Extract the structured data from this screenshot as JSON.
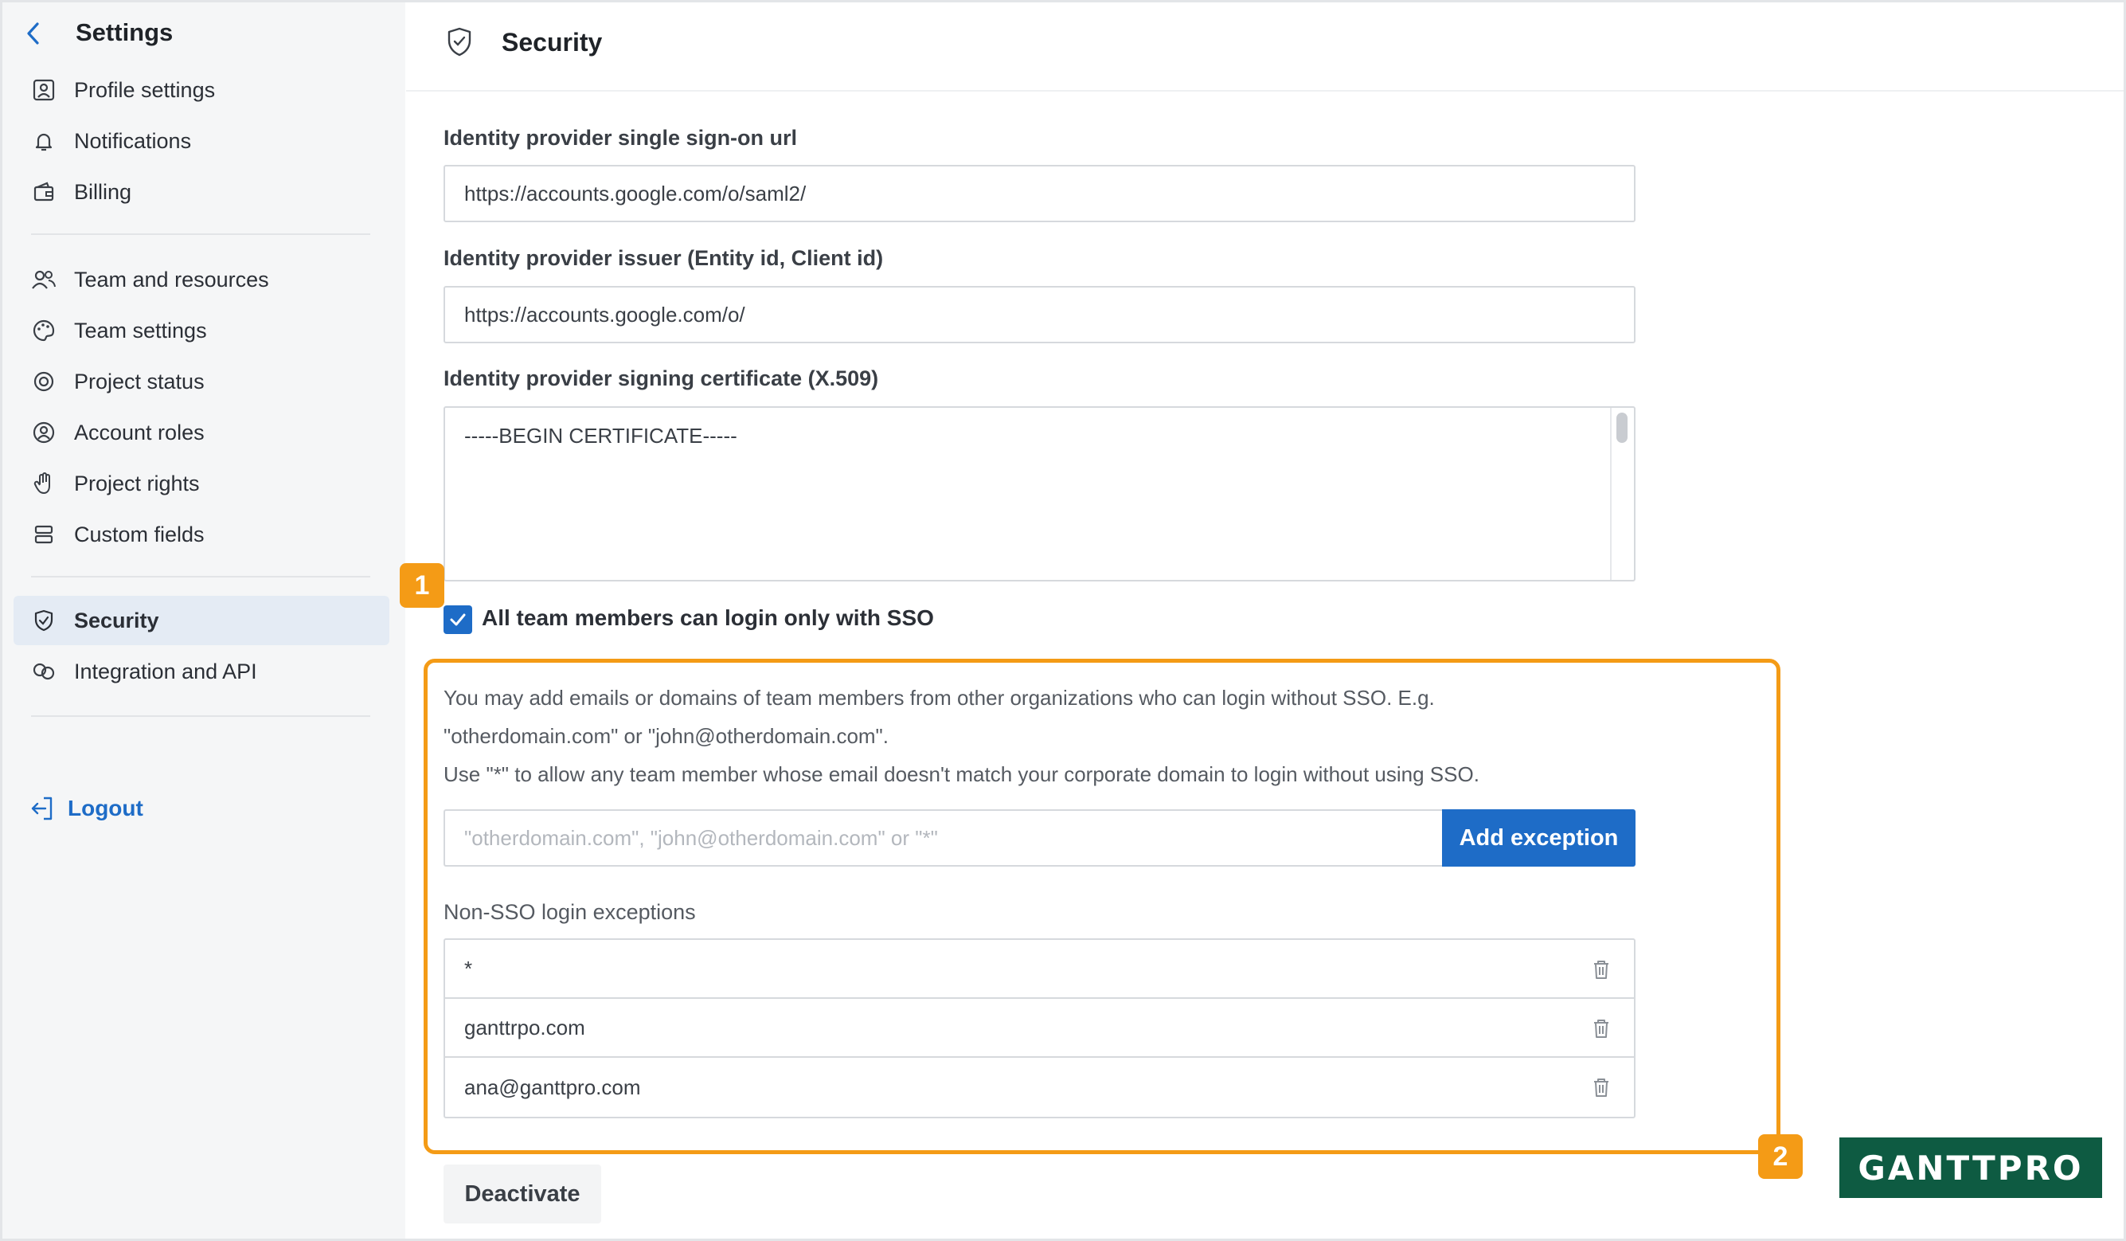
{
  "sidebar": {
    "title": "Settings",
    "items": [
      {
        "label": "Profile settings",
        "icon": "profile-icon"
      },
      {
        "label": "Notifications",
        "icon": "bell-icon"
      },
      {
        "label": "Billing",
        "icon": "wallet-icon"
      },
      {
        "label": "Team and resources",
        "icon": "users-icon"
      },
      {
        "label": "Team settings",
        "icon": "palette-icon"
      },
      {
        "label": "Project status",
        "icon": "status-icon"
      },
      {
        "label": "Account roles",
        "icon": "user-circle-icon"
      },
      {
        "label": "Project rights",
        "icon": "hand-icon"
      },
      {
        "label": "Custom fields",
        "icon": "fields-icon"
      },
      {
        "label": "Security",
        "icon": "shield-icon",
        "active": true
      },
      {
        "label": "Integration and API",
        "icon": "integration-icon"
      }
    ],
    "logout_label": "Logout"
  },
  "main": {
    "title": "Security",
    "sso_url": {
      "label": "Identity provider single sign-on url",
      "value": "https://accounts.google.com/o/saml2/"
    },
    "issuer": {
      "label": "Identity provider issuer (Entity id, Client id)",
      "value": "https://accounts.google.com/o/"
    },
    "certificate": {
      "label": "Identity provider signing certificate (X.509)",
      "value": "-----BEGIN CERTIFICATE-----"
    },
    "sso_only": {
      "label": "All team members can login only with SSO",
      "checked": true
    },
    "help_text": [
      "You may add emails or domains of team members from other organizations who can login without SSO. E.g.",
      "\"otherdomain.com\" or \"john@otherdomain.com\".",
      "Use \"*\" to allow any team member whose email doesn't match your corporate domain to login without using SSO."
    ],
    "exception_input": {
      "placeholder": "\"otherdomain.com\", \"john@otherdomain.com\" or \"*\"",
      "value": ""
    },
    "add_exception_label": "Add exception",
    "exceptions_label": "Non-SSO login exceptions",
    "exceptions": [
      "*",
      "ganttrpo.com",
      "ana@ganttpro.com"
    ],
    "deactivate_label": "Deactivate"
  },
  "annotations": {
    "badge_1": "1",
    "badge_2": "2",
    "accent": "#f49b16"
  },
  "brand": {
    "logo_text": "GANTTPRO",
    "color": "#0e5b42"
  },
  "colors": {
    "primary": "#1e6cc7",
    "sidebar_bg": "#f5f6f7",
    "active_bg": "#e4ebf4"
  }
}
